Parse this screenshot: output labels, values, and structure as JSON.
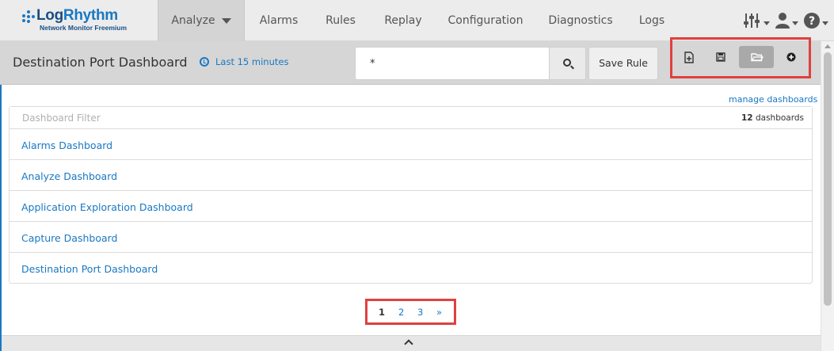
{
  "app": {
    "logo_main_part1": "Log",
    "logo_main_part2": "Rhythm",
    "logo_sub": "Network Monitor Freemium"
  },
  "nav": {
    "items": [
      {
        "label": "Analyze"
      },
      {
        "label": "Alarms"
      },
      {
        "label": "Rules"
      },
      {
        "label": "Replay"
      },
      {
        "label": "Configuration"
      },
      {
        "label": "Diagnostics"
      },
      {
        "label": "Logs"
      }
    ],
    "icons": [
      "sliders-icon",
      "user-icon",
      "help-icon"
    ]
  },
  "header": {
    "title": "Destination Port Dashboard",
    "time_range": "Last 15 minutes",
    "search_value": "*",
    "save_rule_label": "Save Rule"
  },
  "toolbar": {
    "buttons": [
      "new-dashboard-icon",
      "save-icon",
      "open-folder-icon",
      "add-widget-icon"
    ]
  },
  "dashboards": {
    "manage_label": "manage dashboards",
    "filter_placeholder": "Dashboard Filter",
    "count": "12",
    "count_suffix": "dashboards",
    "items": [
      {
        "label": "Alarms Dashboard"
      },
      {
        "label": "Analyze Dashboard"
      },
      {
        "label": "Application Exploration Dashboard"
      },
      {
        "label": "Capture Dashboard"
      },
      {
        "label": "Destination Port Dashboard"
      }
    ]
  },
  "pagination": {
    "pages": [
      "1",
      "2",
      "3"
    ],
    "next_label": "»",
    "current": "1"
  },
  "colors": {
    "accent": "#1a78c2",
    "highlight": "#e0403f",
    "nav_bg": "#ececec",
    "header_bg": "#d6d6d6"
  }
}
